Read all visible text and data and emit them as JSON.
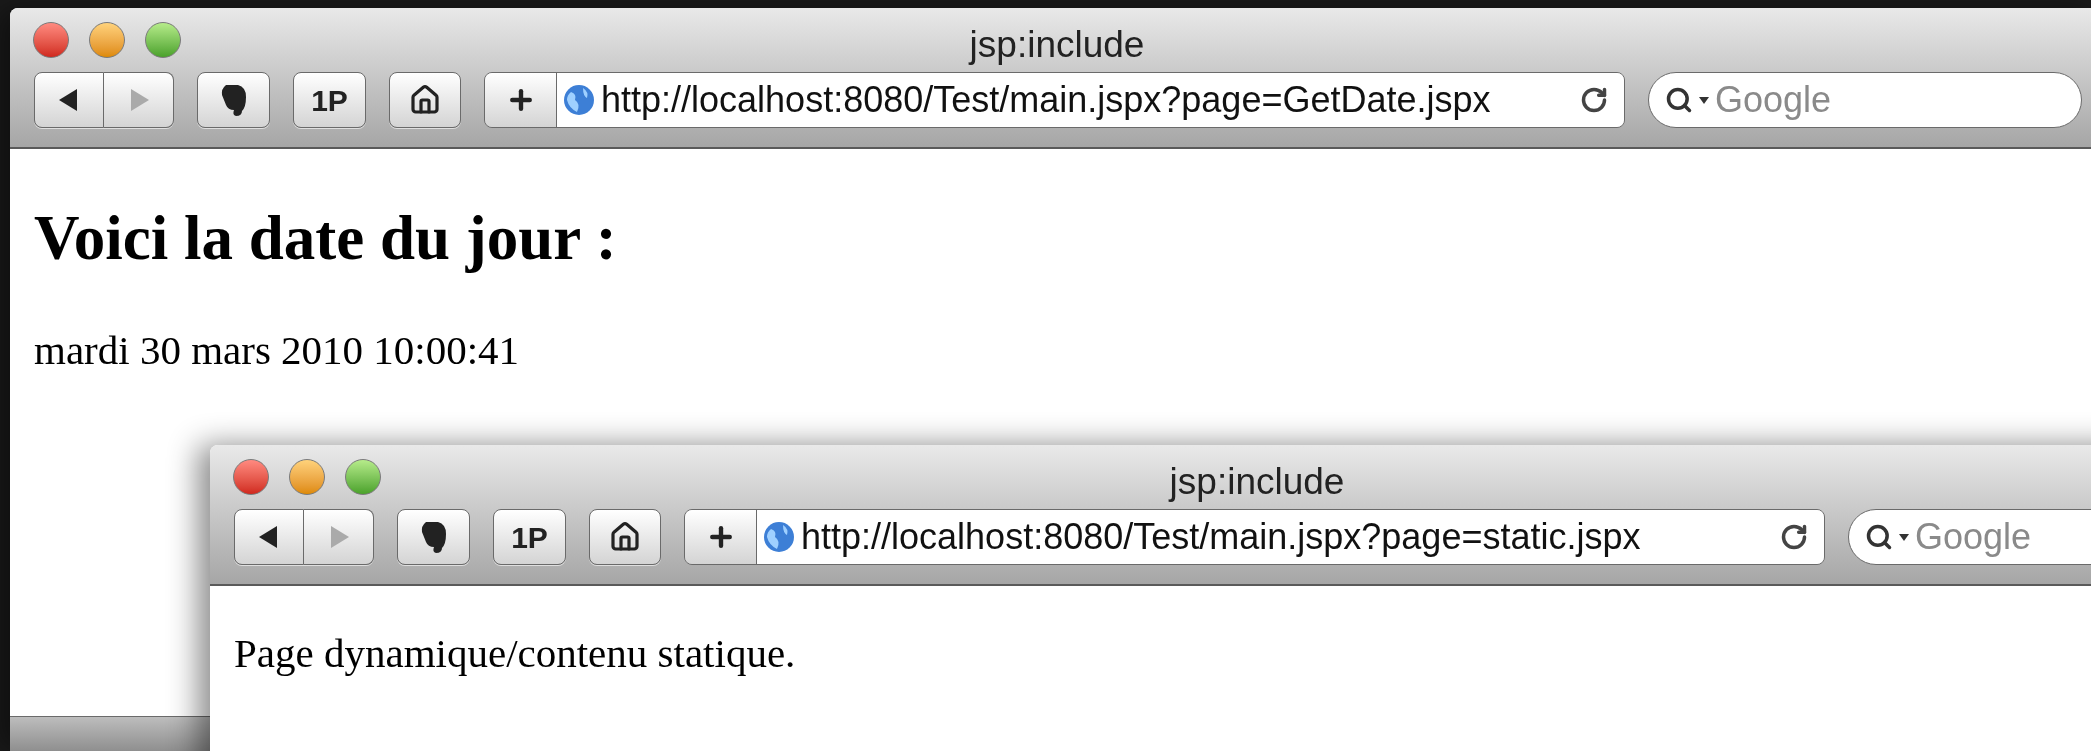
{
  "windows": [
    {
      "title": "jsp:include",
      "forward_disabled": true,
      "password_button": "1P",
      "url": "http://localhost:8080/Test/main.jspx?page=GetDate.jspx",
      "search_placeholder": "Google",
      "status_bar": true,
      "content": [
        {
          "kind": "heading",
          "text": "Voici la date du jour :"
        },
        {
          "kind": "paragraph",
          "text": "mardi 30 mars 2010 10:00:41"
        }
      ]
    },
    {
      "title": "jsp:include",
      "forward_disabled": true,
      "password_button": "1P",
      "url": "http://localhost:8080/Test/main.jspx?page=static.jspx",
      "search_placeholder": "Google",
      "content": [
        {
          "kind": "paragraph",
          "text": "Page dynamique/contenu statique."
        }
      ]
    }
  ]
}
